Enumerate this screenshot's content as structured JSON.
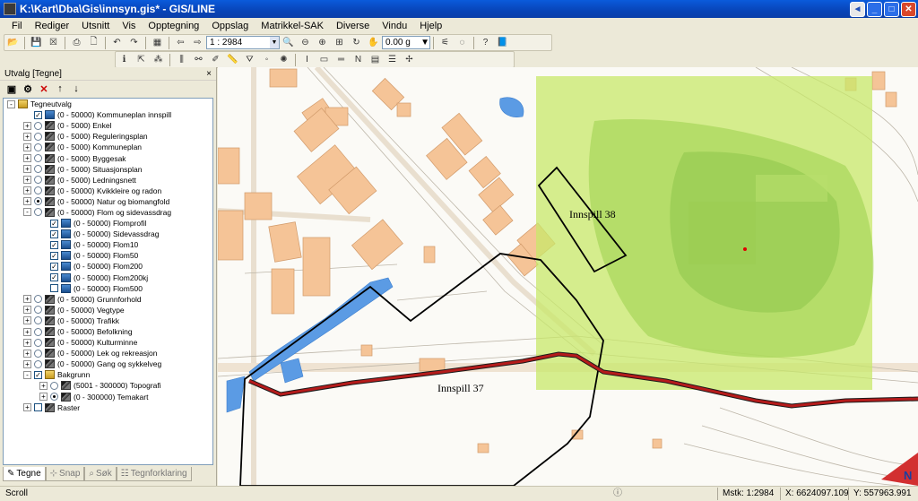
{
  "window": {
    "title": "K:\\Kart\\Dba\\Gis\\innsyn.gis* - GIS/LINE",
    "buttons": {
      "help": "◄",
      "minimize": "_",
      "maximize": "□",
      "close": "✕"
    }
  },
  "menu": [
    "Fil",
    "Rediger",
    "Utsnitt",
    "Vis",
    "Opptegning",
    "Oppslag",
    "Matrikkel-SAK",
    "Diverse",
    "Vindu",
    "Hjelp"
  ],
  "toolbar": {
    "scale_value": "1 : 2984",
    "measure_value": "0.00 g"
  },
  "panel": {
    "title": "Utvalg [Tegne]",
    "close": "×",
    "tree": [
      {
        "indent": 0,
        "exp": "-",
        "check": "none",
        "icon": "bag",
        "label": "Tegneutvalg"
      },
      {
        "indent": 1,
        "exp": "",
        "check": "checked",
        "icon": "lock",
        "label": "(0 - 50000) Kommuneplan innspill"
      },
      {
        "indent": 1,
        "exp": "+",
        "check": "radio",
        "icon": "layer",
        "label": "(0 - 5000) Enkel"
      },
      {
        "indent": 1,
        "exp": "+",
        "check": "radio",
        "icon": "layer",
        "label": "(0 - 5000) Reguleringsplan"
      },
      {
        "indent": 1,
        "exp": "+",
        "check": "radio",
        "icon": "layer",
        "label": "(0 - 5000) Kommuneplan"
      },
      {
        "indent": 1,
        "exp": "+",
        "check": "radio",
        "icon": "layer",
        "label": "(0 - 5000) Byggesak"
      },
      {
        "indent": 1,
        "exp": "+",
        "check": "radio",
        "icon": "layer",
        "label": "(0 - 5000) Situasjonsplan"
      },
      {
        "indent": 1,
        "exp": "+",
        "check": "radio",
        "icon": "layer",
        "label": "(0 - 5000) Ledningsnett"
      },
      {
        "indent": 1,
        "exp": "+",
        "check": "radio",
        "icon": "layer",
        "label": "(0 - 50000) Kvikkleire og radon"
      },
      {
        "indent": 1,
        "exp": "+",
        "check": "radio-on",
        "icon": "layer",
        "label": "(0 - 50000) Natur og biomangfold"
      },
      {
        "indent": 1,
        "exp": "-",
        "check": "radio",
        "icon": "layer",
        "label": "(0 - 50000) Flom og sidevassdrag"
      },
      {
        "indent": 2,
        "exp": "",
        "check": "checked",
        "icon": "lock",
        "label": "(0 - 50000) Flomprofil"
      },
      {
        "indent": 2,
        "exp": "",
        "check": "checked",
        "icon": "lock",
        "label": "(0 - 50000) Sidevassdrag"
      },
      {
        "indent": 2,
        "exp": "",
        "check": "checked",
        "icon": "lock",
        "label": "(0 - 50000) Flom10"
      },
      {
        "indent": 2,
        "exp": "",
        "check": "checked",
        "icon": "lock",
        "label": "(0 - 50000) Flom50"
      },
      {
        "indent": 2,
        "exp": "",
        "check": "checked",
        "icon": "lock",
        "label": "(0 - 50000) Flom200"
      },
      {
        "indent": 2,
        "exp": "",
        "check": "checked",
        "icon": "lock",
        "label": "(0 - 50000) Flom200kj"
      },
      {
        "indent": 2,
        "exp": "",
        "check": "unchecked",
        "icon": "lock",
        "label": "(0 - 50000) Flom500"
      },
      {
        "indent": 1,
        "exp": "+",
        "check": "radio",
        "icon": "layer",
        "label": "(0 - 50000) Grunnforhold"
      },
      {
        "indent": 1,
        "exp": "+",
        "check": "radio",
        "icon": "layer",
        "label": "(0 - 50000) Vegtype"
      },
      {
        "indent": 1,
        "exp": "+",
        "check": "radio",
        "icon": "layer",
        "label": "(0 - 50000) Trafikk"
      },
      {
        "indent": 1,
        "exp": "+",
        "check": "radio",
        "icon": "layer",
        "label": "(0 - 50000) Befolkning"
      },
      {
        "indent": 1,
        "exp": "+",
        "check": "radio",
        "icon": "layer",
        "label": "(0 - 50000) Kulturminne"
      },
      {
        "indent": 1,
        "exp": "+",
        "check": "radio",
        "icon": "layer",
        "label": "(0 - 50000) Lek og rekreasjon"
      },
      {
        "indent": 1,
        "exp": "+",
        "check": "radio",
        "icon": "layer",
        "label": "(0 - 50000) Gang og sykkelveg"
      },
      {
        "indent": 1,
        "exp": "-",
        "check": "checked",
        "icon": "bag",
        "label": "Bakgrunn"
      },
      {
        "indent": 2,
        "exp": "+",
        "check": "radio",
        "icon": "layer",
        "label": "(5001 - 300000) Topografi"
      },
      {
        "indent": 2,
        "exp": "+",
        "check": "radio-on",
        "icon": "layer",
        "label": "(0 - 300000) Temakart"
      },
      {
        "indent": 1,
        "exp": "+",
        "check": "unchecked",
        "icon": "layer",
        "label": "Raster"
      }
    ],
    "tabs": [
      {
        "label": "Tegne",
        "icon": "✎",
        "active": true
      },
      {
        "label": "Snap",
        "icon": "⊹",
        "active": false
      },
      {
        "label": "Søk",
        "icon": "⌕",
        "active": false
      },
      {
        "label": "Tegnforklaring",
        "icon": "☷",
        "active": false
      }
    ]
  },
  "map": {
    "labels": {
      "innspill_38": "Innspill 38",
      "innspill_37": "Innspill 37"
    },
    "colors": {
      "building": "#f5c497",
      "water": "#5b9be4",
      "green": "#c8e86a",
      "road_red": "#b51b1b"
    }
  },
  "status": {
    "mode": "Scroll",
    "scale_text": "Mstk: 1:2984",
    "x_text": "X: 6624097.109",
    "y_text": "Y: 557963.991"
  }
}
